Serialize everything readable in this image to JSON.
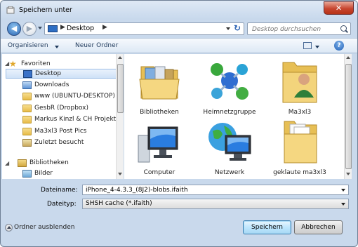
{
  "window": {
    "title": "Speichern unter",
    "close_label": "✕"
  },
  "nav": {
    "back": "◀",
    "forward": "▶",
    "address_location": "Desktop",
    "address_chevron": "▶",
    "refresh": "↻",
    "search_placeholder": "Desktop durchsuchen"
  },
  "toolbar": {
    "organize_label": "Organisieren",
    "new_folder_label": "Neuer Ordner",
    "help_label": "?"
  },
  "navpane": {
    "items": [
      {
        "label": "Favoriten",
        "icon": "star-icon"
      },
      {
        "label": "Desktop",
        "icon": "desktop-icon",
        "selected": true
      },
      {
        "label": "Downloads",
        "icon": "downloads-icon"
      },
      {
        "label": "www (UBUNTU-DESKTOP)",
        "icon": "folder-icon"
      },
      {
        "label": "GesbR (Dropbox)",
        "icon": "folder-icon"
      },
      {
        "label": "Markus Kinzl & CH Projekte",
        "icon": "folder-icon"
      },
      {
        "label": "Ma3xl3 Post Pics",
        "icon": "folder-icon"
      },
      {
        "label": "Zuletzt besucht",
        "icon": "recent-places-icon"
      },
      {
        "label": "Bibliotheken",
        "icon": "libraries-icon"
      },
      {
        "label": "Bilder",
        "icon": "pictures-icon"
      }
    ]
  },
  "content": {
    "items": [
      {
        "label": "Bibliotheken",
        "icon": "libraries-folder-icon"
      },
      {
        "label": "Heimnetzgruppe",
        "icon": "homegroup-icon"
      },
      {
        "label": "Ma3xl3",
        "icon": "user-folder-icon"
      },
      {
        "label": "Computer",
        "icon": "computer-icon"
      },
      {
        "label": "Netzwerk",
        "icon": "network-icon"
      },
      {
        "label": "geklaute ma3xl3",
        "icon": "folder-icon"
      }
    ]
  },
  "save": {
    "filename_label": "Dateiname:",
    "filename_value": "iPhone_4-4.3.3_(8J2)-blobs.ifaith",
    "filetype_label": "Dateityp:",
    "filetype_value": "SHSH cache (*.ifaith)",
    "hide_folders_label": "Ordner ausblenden",
    "save_button": "Speichern",
    "cancel_button": "Abbrechen"
  },
  "colors": {
    "frame": "#c9d9ec",
    "accent": "#2a67b5",
    "close": "#c7452f",
    "selection": "#cfe2f7"
  }
}
